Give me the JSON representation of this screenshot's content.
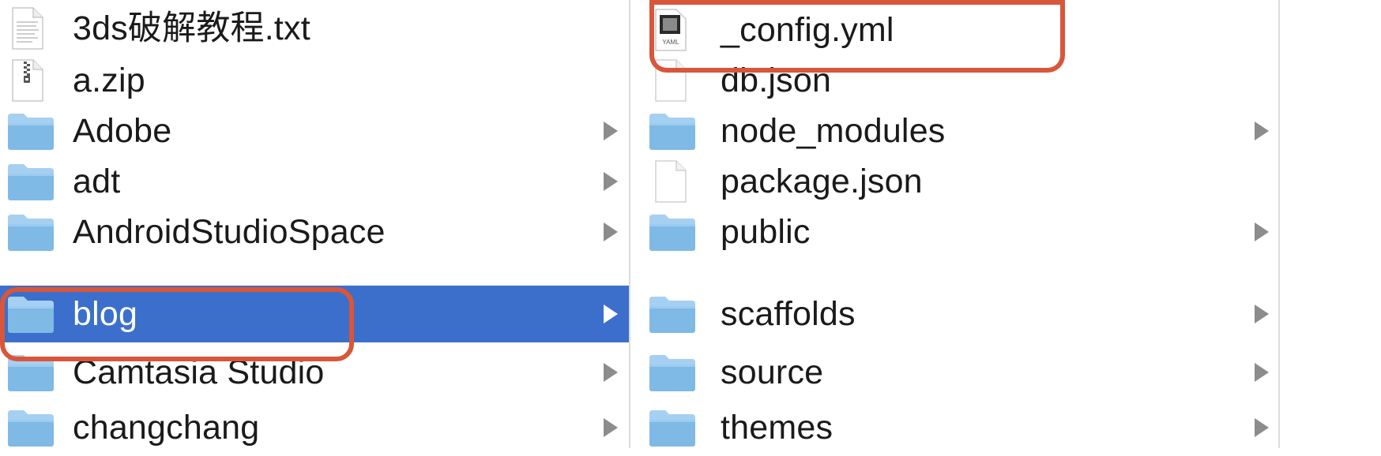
{
  "left_column": {
    "items": [
      {
        "label": "3ds破解教程.txt",
        "icon": "text-file-icon",
        "has_children": false,
        "selected": false
      },
      {
        "label": "a.zip",
        "icon": "zip-file-icon",
        "has_children": false,
        "selected": false
      },
      {
        "label": "Adobe",
        "icon": "folder-icon",
        "has_children": true,
        "selected": false
      },
      {
        "label": "adt",
        "icon": "folder-icon",
        "has_children": true,
        "selected": false
      },
      {
        "label": "AndroidStudioSpace",
        "icon": "folder-icon",
        "has_children": true,
        "selected": false
      },
      {
        "label": "blog",
        "icon": "folder-icon",
        "has_children": true,
        "selected": true
      },
      {
        "label": "Camtasia Studio",
        "icon": "folder-icon",
        "has_children": true,
        "selected": false
      },
      {
        "label": "changchang",
        "icon": "folder-icon",
        "has_children": true,
        "selected": false
      }
    ]
  },
  "right_column": {
    "items": [
      {
        "label": "_config.yml",
        "icon": "yaml-file-icon",
        "has_children": false,
        "selected": false
      },
      {
        "label": "db.json",
        "icon": "document-icon",
        "has_children": false,
        "selected": false
      },
      {
        "label": "node_modules",
        "icon": "folder-icon",
        "has_children": true,
        "selected": false
      },
      {
        "label": "package.json",
        "icon": "document-icon",
        "has_children": false,
        "selected": false
      },
      {
        "label": "public",
        "icon": "folder-icon",
        "has_children": true,
        "selected": false
      },
      {
        "label": "scaffolds",
        "icon": "folder-icon",
        "has_children": true,
        "selected": false
      },
      {
        "label": "source",
        "icon": "folder-icon",
        "has_children": true,
        "selected": false
      },
      {
        "label": "themes",
        "icon": "folder-icon",
        "has_children": true,
        "selected": false
      }
    ]
  },
  "icons": {
    "yaml_badge_text": "YAML"
  },
  "colors": {
    "selection": "#3b6fcb",
    "annotation": "#d9563a",
    "folder_body": "#7fb9e6",
    "folder_top": "#a6d0f1",
    "disclosure_arrow": "#8c8c8c"
  }
}
